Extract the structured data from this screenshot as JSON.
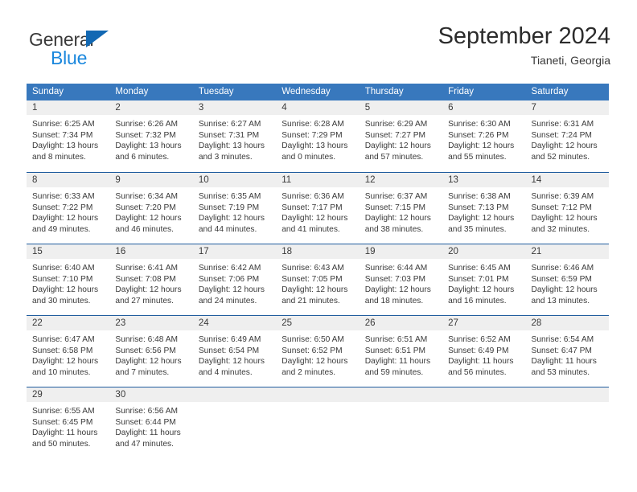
{
  "brand": {
    "name_top": "General",
    "name_bottom": "Blue",
    "triangle_color": "#1268b3",
    "blue_color": "#1a87dd"
  },
  "header": {
    "title": "September 2024",
    "subtitle": "Tianeti, Georgia"
  },
  "colors": {
    "header_bar": "#3878bd",
    "row_divider": "#205d9e",
    "daynum_band": "#efefef",
    "text": "#3a3a3a"
  },
  "weekdays": [
    "Sunday",
    "Monday",
    "Tuesday",
    "Wednesday",
    "Thursday",
    "Friday",
    "Saturday"
  ],
  "weeks": [
    [
      {
        "day": "1",
        "sunrise": "Sunrise: 6:25 AM",
        "sunset": "Sunset: 7:34 PM",
        "daylight": "Daylight: 13 hours and 8 minutes."
      },
      {
        "day": "2",
        "sunrise": "Sunrise: 6:26 AM",
        "sunset": "Sunset: 7:32 PM",
        "daylight": "Daylight: 13 hours and 6 minutes."
      },
      {
        "day": "3",
        "sunrise": "Sunrise: 6:27 AM",
        "sunset": "Sunset: 7:31 PM",
        "daylight": "Daylight: 13 hours and 3 minutes."
      },
      {
        "day": "4",
        "sunrise": "Sunrise: 6:28 AM",
        "sunset": "Sunset: 7:29 PM",
        "daylight": "Daylight: 13 hours and 0 minutes."
      },
      {
        "day": "5",
        "sunrise": "Sunrise: 6:29 AM",
        "sunset": "Sunset: 7:27 PM",
        "daylight": "Daylight: 12 hours and 57 minutes."
      },
      {
        "day": "6",
        "sunrise": "Sunrise: 6:30 AM",
        "sunset": "Sunset: 7:26 PM",
        "daylight": "Daylight: 12 hours and 55 minutes."
      },
      {
        "day": "7",
        "sunrise": "Sunrise: 6:31 AM",
        "sunset": "Sunset: 7:24 PM",
        "daylight": "Daylight: 12 hours and 52 minutes."
      }
    ],
    [
      {
        "day": "8",
        "sunrise": "Sunrise: 6:33 AM",
        "sunset": "Sunset: 7:22 PM",
        "daylight": "Daylight: 12 hours and 49 minutes."
      },
      {
        "day": "9",
        "sunrise": "Sunrise: 6:34 AM",
        "sunset": "Sunset: 7:20 PM",
        "daylight": "Daylight: 12 hours and 46 minutes."
      },
      {
        "day": "10",
        "sunrise": "Sunrise: 6:35 AM",
        "sunset": "Sunset: 7:19 PM",
        "daylight": "Daylight: 12 hours and 44 minutes."
      },
      {
        "day": "11",
        "sunrise": "Sunrise: 6:36 AM",
        "sunset": "Sunset: 7:17 PM",
        "daylight": "Daylight: 12 hours and 41 minutes."
      },
      {
        "day": "12",
        "sunrise": "Sunrise: 6:37 AM",
        "sunset": "Sunset: 7:15 PM",
        "daylight": "Daylight: 12 hours and 38 minutes."
      },
      {
        "day": "13",
        "sunrise": "Sunrise: 6:38 AM",
        "sunset": "Sunset: 7:13 PM",
        "daylight": "Daylight: 12 hours and 35 minutes."
      },
      {
        "day": "14",
        "sunrise": "Sunrise: 6:39 AM",
        "sunset": "Sunset: 7:12 PM",
        "daylight": "Daylight: 12 hours and 32 minutes."
      }
    ],
    [
      {
        "day": "15",
        "sunrise": "Sunrise: 6:40 AM",
        "sunset": "Sunset: 7:10 PM",
        "daylight": "Daylight: 12 hours and 30 minutes."
      },
      {
        "day": "16",
        "sunrise": "Sunrise: 6:41 AM",
        "sunset": "Sunset: 7:08 PM",
        "daylight": "Daylight: 12 hours and 27 minutes."
      },
      {
        "day": "17",
        "sunrise": "Sunrise: 6:42 AM",
        "sunset": "Sunset: 7:06 PM",
        "daylight": "Daylight: 12 hours and 24 minutes."
      },
      {
        "day": "18",
        "sunrise": "Sunrise: 6:43 AM",
        "sunset": "Sunset: 7:05 PM",
        "daylight": "Daylight: 12 hours and 21 minutes."
      },
      {
        "day": "19",
        "sunrise": "Sunrise: 6:44 AM",
        "sunset": "Sunset: 7:03 PM",
        "daylight": "Daylight: 12 hours and 18 minutes."
      },
      {
        "day": "20",
        "sunrise": "Sunrise: 6:45 AM",
        "sunset": "Sunset: 7:01 PM",
        "daylight": "Daylight: 12 hours and 16 minutes."
      },
      {
        "day": "21",
        "sunrise": "Sunrise: 6:46 AM",
        "sunset": "Sunset: 6:59 PM",
        "daylight": "Daylight: 12 hours and 13 minutes."
      }
    ],
    [
      {
        "day": "22",
        "sunrise": "Sunrise: 6:47 AM",
        "sunset": "Sunset: 6:58 PM",
        "daylight": "Daylight: 12 hours and 10 minutes."
      },
      {
        "day": "23",
        "sunrise": "Sunrise: 6:48 AM",
        "sunset": "Sunset: 6:56 PM",
        "daylight": "Daylight: 12 hours and 7 minutes."
      },
      {
        "day": "24",
        "sunrise": "Sunrise: 6:49 AM",
        "sunset": "Sunset: 6:54 PM",
        "daylight": "Daylight: 12 hours and 4 minutes."
      },
      {
        "day": "25",
        "sunrise": "Sunrise: 6:50 AM",
        "sunset": "Sunset: 6:52 PM",
        "daylight": "Daylight: 12 hours and 2 minutes."
      },
      {
        "day": "26",
        "sunrise": "Sunrise: 6:51 AM",
        "sunset": "Sunset: 6:51 PM",
        "daylight": "Daylight: 11 hours and 59 minutes."
      },
      {
        "day": "27",
        "sunrise": "Sunrise: 6:52 AM",
        "sunset": "Sunset: 6:49 PM",
        "daylight": "Daylight: 11 hours and 56 minutes."
      },
      {
        "day": "28",
        "sunrise": "Sunrise: 6:54 AM",
        "sunset": "Sunset: 6:47 PM",
        "daylight": "Daylight: 11 hours and 53 minutes."
      }
    ],
    [
      {
        "day": "29",
        "sunrise": "Sunrise: 6:55 AM",
        "sunset": "Sunset: 6:45 PM",
        "daylight": "Daylight: 11 hours and 50 minutes."
      },
      {
        "day": "30",
        "sunrise": "Sunrise: 6:56 AM",
        "sunset": "Sunset: 6:44 PM",
        "daylight": "Daylight: 11 hours and 47 minutes."
      },
      {
        "day": "",
        "sunrise": "",
        "sunset": "",
        "daylight": ""
      },
      {
        "day": "",
        "sunrise": "",
        "sunset": "",
        "daylight": ""
      },
      {
        "day": "",
        "sunrise": "",
        "sunset": "",
        "daylight": ""
      },
      {
        "day": "",
        "sunrise": "",
        "sunset": "",
        "daylight": ""
      },
      {
        "day": "",
        "sunrise": "",
        "sunset": "",
        "daylight": ""
      }
    ]
  ]
}
